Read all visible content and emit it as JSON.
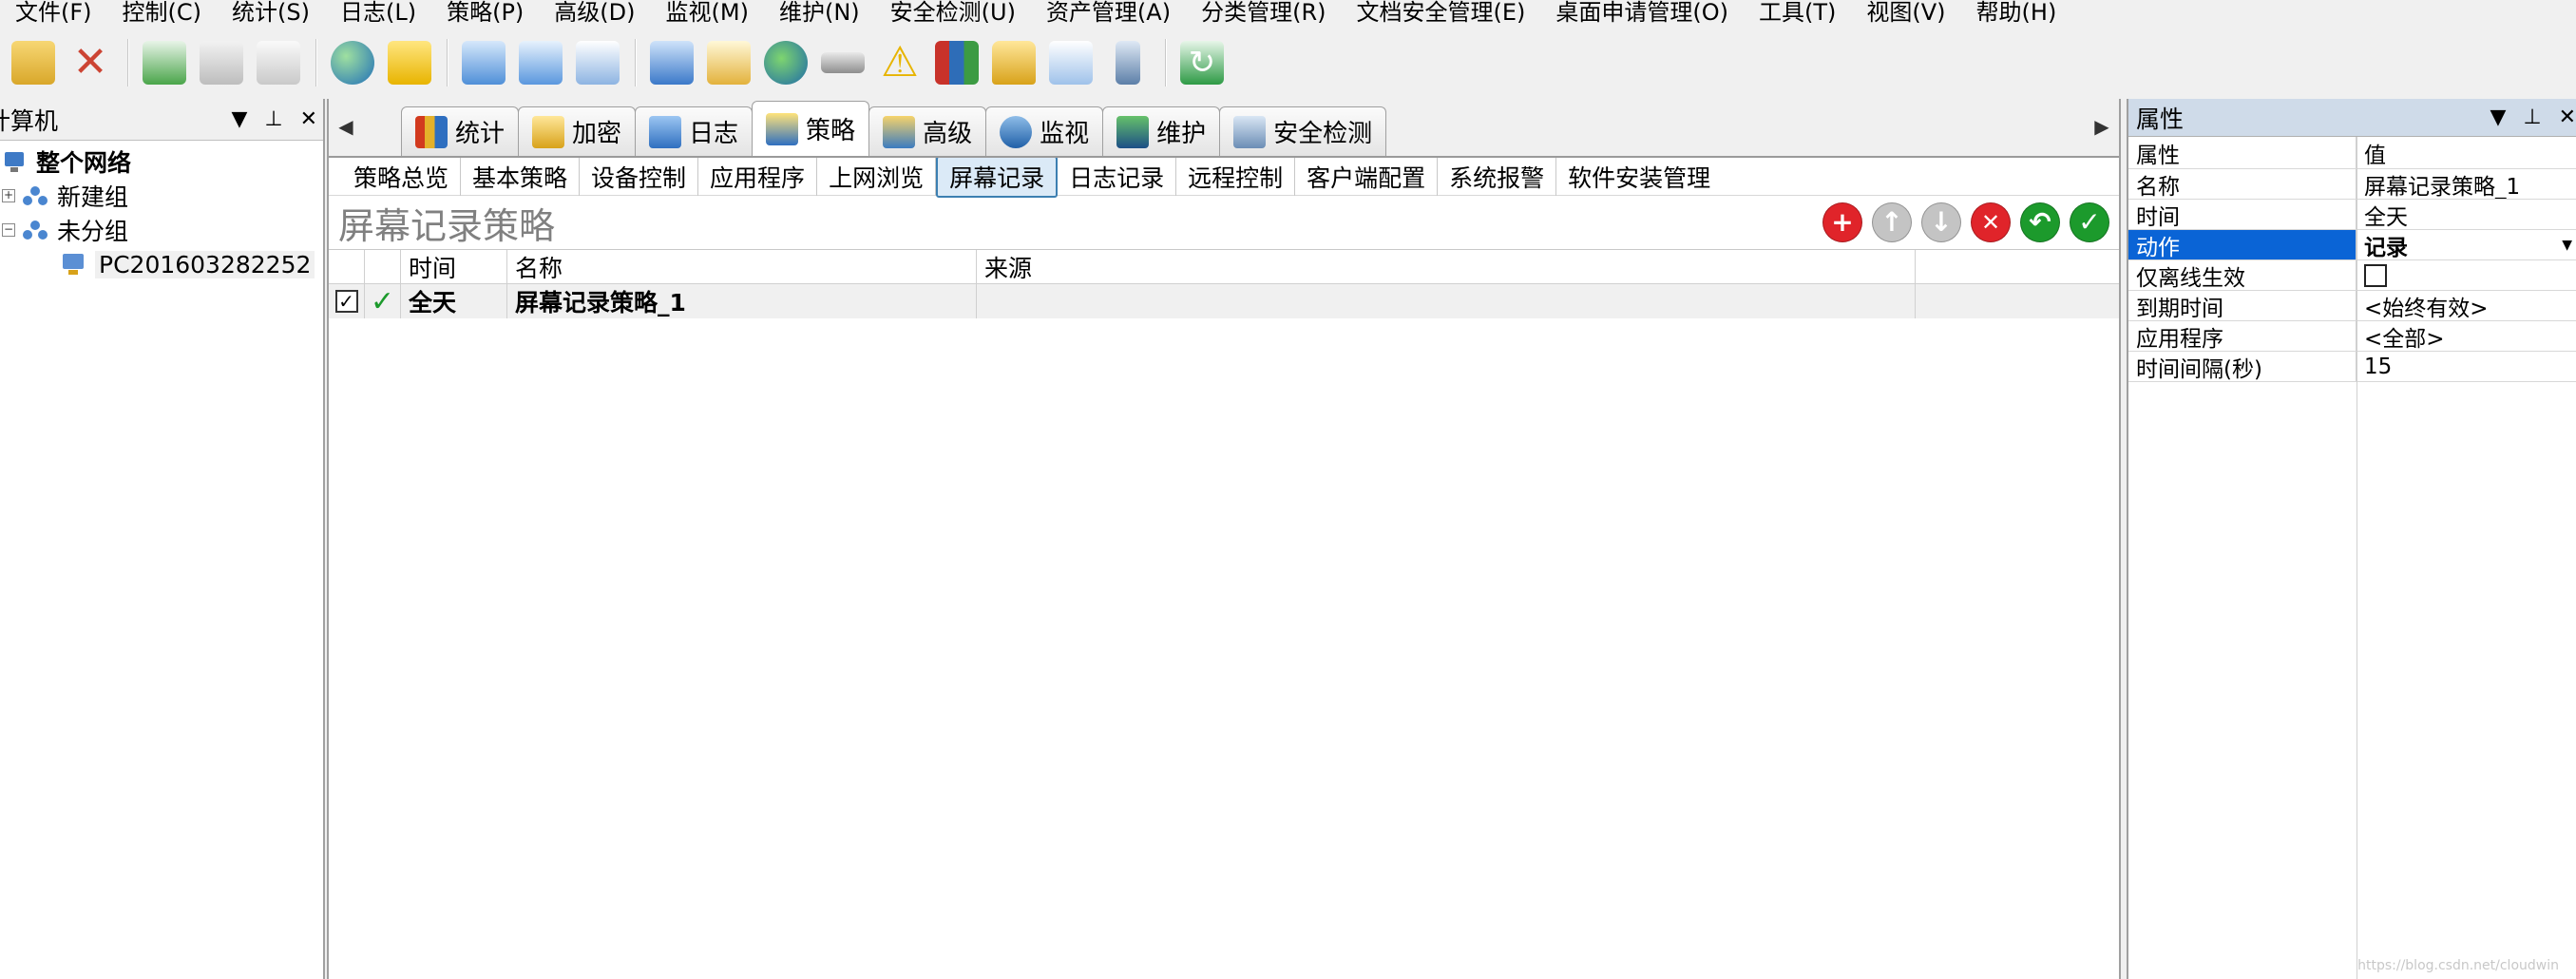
{
  "menu": [
    "文件(F)",
    "控制(C)",
    "统计(S)",
    "日志(L)",
    "策略(P)",
    "高级(D)",
    "监视(M)",
    "维护(N)",
    "安全检测(U)",
    "资产管理(A)",
    "分类管理(R)",
    "文档安全管理(E)",
    "桌面申请管理(O)",
    "工具(T)",
    "视图(V)",
    "帮助(H)"
  ],
  "toolbar_icons": [
    "open-folder",
    "delete",
    "import",
    "print",
    "print-preview",
    "globe-mouse",
    "note",
    "copy-pages",
    "search-window",
    "document-view",
    "network-computer",
    "log-window",
    "internet-explorer",
    "drive",
    "warning",
    "chart-book",
    "lock",
    "edit-note",
    "mobile-device",
    "refresh"
  ],
  "left_panel": {
    "title": "计算机",
    "tree": [
      {
        "label": "整个网络",
        "level": 0,
        "bold": true
      },
      {
        "label": "新建组",
        "level": 1
      },
      {
        "label": "未分组",
        "level": 1
      },
      {
        "label": "PC201603282252",
        "level": 2
      }
    ]
  },
  "tabs": [
    {
      "label": "统计",
      "icon": "stats-icon",
      "color": "#d23a1e"
    },
    {
      "label": "加密",
      "icon": "lock-icon",
      "color": "#e2a41a"
    },
    {
      "label": "日志",
      "icon": "log-icon",
      "color": "#2f6fc0"
    },
    {
      "label": "策略",
      "icon": "policy-icon",
      "color": "#2f6fc0",
      "active": true
    },
    {
      "label": "高级",
      "icon": "advanced-icon",
      "color": "#3b7bc0"
    },
    {
      "label": "监视",
      "icon": "monitor-icon",
      "color": "#2060a8"
    },
    {
      "label": "维护",
      "icon": "maintain-icon",
      "color": "#1c4f86"
    },
    {
      "label": "安全检测",
      "icon": "security-icon",
      "color": "#6b8db5"
    }
  ],
  "subnav": [
    "策略总览",
    "基本策略",
    "设备控制",
    "应用程序",
    "上网浏览",
    "屏幕记录",
    "日志记录",
    "远程控制",
    "客户端配置",
    "系统报警",
    "软件安装管理"
  ],
  "subnav_active": "屏幕记录",
  "policy": {
    "title": "屏幕记录策略",
    "columns": {
      "time": "时间",
      "name": "名称",
      "source": "来源"
    },
    "rows": [
      {
        "checked": true,
        "enabled": true,
        "time": "全天",
        "name": "屏幕记录策略_1",
        "source": ""
      }
    ]
  },
  "properties": {
    "title": "属性",
    "header": {
      "key": "属性",
      "value": "值"
    },
    "rows": [
      {
        "key": "名称",
        "value": "屏幕记录策略_1"
      },
      {
        "key": "时间",
        "value": "全天"
      },
      {
        "key": "动作",
        "value": "记录",
        "selected": true
      },
      {
        "key": "仅离线生效",
        "value": ""
      },
      {
        "key": "到期时间",
        "value": "<始终有效>"
      },
      {
        "key": "应用程序",
        "value": "<全部>"
      },
      {
        "key": "时间间隔(秒)",
        "value": "15"
      }
    ]
  },
  "colors": {
    "selection": "#0a64d6",
    "add": "#e0242a",
    "delete": "#e0242a",
    "ok": "#1c9a2c",
    "disabled": "#b8b8b8",
    "panel_title": "#cfdbe9"
  },
  "watermark": "https://blog.csdn.net/cloudwin"
}
